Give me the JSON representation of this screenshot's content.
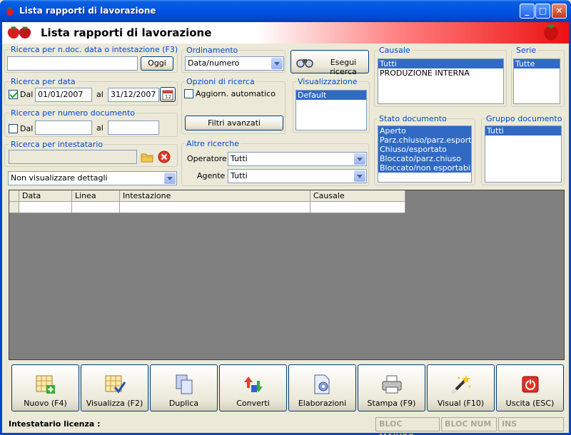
{
  "window": {
    "title": "Lista rapporti di lavorazione"
  },
  "header": {
    "title": "Lista rapporti di lavorazione"
  },
  "search_doc": {
    "label": "Ricerca per n.doc. data o intestazione (F3)",
    "value": "",
    "button": "Oggi"
  },
  "search_date": {
    "label": "Ricerca per data",
    "dal_label": "Dal",
    "dal_checked": true,
    "from": "01/01/2007",
    "al_label": "al",
    "to": "31/12/2007"
  },
  "search_number": {
    "label": "Ricerca per numero documento",
    "dal_label": "Dal",
    "dal_checked": false,
    "from": "",
    "al_label": "al",
    "to": ""
  },
  "search_holder": {
    "label": "Ricerca per intestatario",
    "value": ""
  },
  "details_combo": {
    "value": "Non visualizzare dettagli"
  },
  "ordering": {
    "label": "Ordinamento",
    "value": "Data/numero"
  },
  "search_options": {
    "label": "Opzioni di ricerca",
    "auto_label": "Aggiorn. automatico",
    "auto_checked": false,
    "filters_button": "Filtri avanzati"
  },
  "execute_button": {
    "label": "Esegui ricerca"
  },
  "view": {
    "label": "Visualizzazione",
    "items": [
      {
        "text": "Default",
        "selected": true
      }
    ]
  },
  "other_searches": {
    "label": "Altre ricerche",
    "operator_label": "Operatore :",
    "operator_value": "Tutti",
    "agent_label": "Agente :",
    "agent_value": "Tutti"
  },
  "causale": {
    "label": "Causale",
    "items": [
      {
        "text": "Tutti",
        "selected": true
      },
      {
        "text": "PRODUZIONE INTERNA",
        "selected": false
      }
    ]
  },
  "serie": {
    "label": "Serie",
    "items": [
      {
        "text": "Tutte",
        "selected": true
      }
    ]
  },
  "doc_state": {
    "label": "Stato documento",
    "items": [
      {
        "text": "Aperto",
        "selected": true
      },
      {
        "text": "Parz.chiuso/parz.esportato",
        "selected": true
      },
      {
        "text": "Chiuso/esportato",
        "selected": true
      },
      {
        "text": "Bloccato/parz.chiuso",
        "selected": true
      },
      {
        "text": "Bloccato/non esportabile",
        "selected": true
      }
    ]
  },
  "doc_group": {
    "label": "Gruppo documento",
    "items": [
      {
        "text": "Tutti",
        "selected": true
      }
    ]
  },
  "grid": {
    "columns": [
      "Data",
      "Linea",
      "Intestazione",
      "Causale"
    ]
  },
  "toolbar": [
    {
      "name": "nuovo",
      "label": "Nuovo (F4)"
    },
    {
      "name": "visualizza",
      "label": "Visualizza (F2)"
    },
    {
      "name": "duplica",
      "label": "Duplica"
    },
    {
      "name": "converti",
      "label": "Converti"
    },
    {
      "name": "elaborazioni",
      "label": "Elaborazioni"
    },
    {
      "name": "stampa",
      "label": "Stampa (F9)"
    },
    {
      "name": "visual",
      "label": "Visual (F10)"
    },
    {
      "name": "uscita",
      "label": "Uscita (ESC)"
    }
  ],
  "status": {
    "license": "Intestatario licenza :",
    "caps": "BLOC MAIUSC",
    "num": "BLOC NUM",
    "ins": "INS"
  },
  "colors": {
    "titlebar": "#0054e3",
    "selection": "#316ac5",
    "group_label": "#0046d5"
  }
}
